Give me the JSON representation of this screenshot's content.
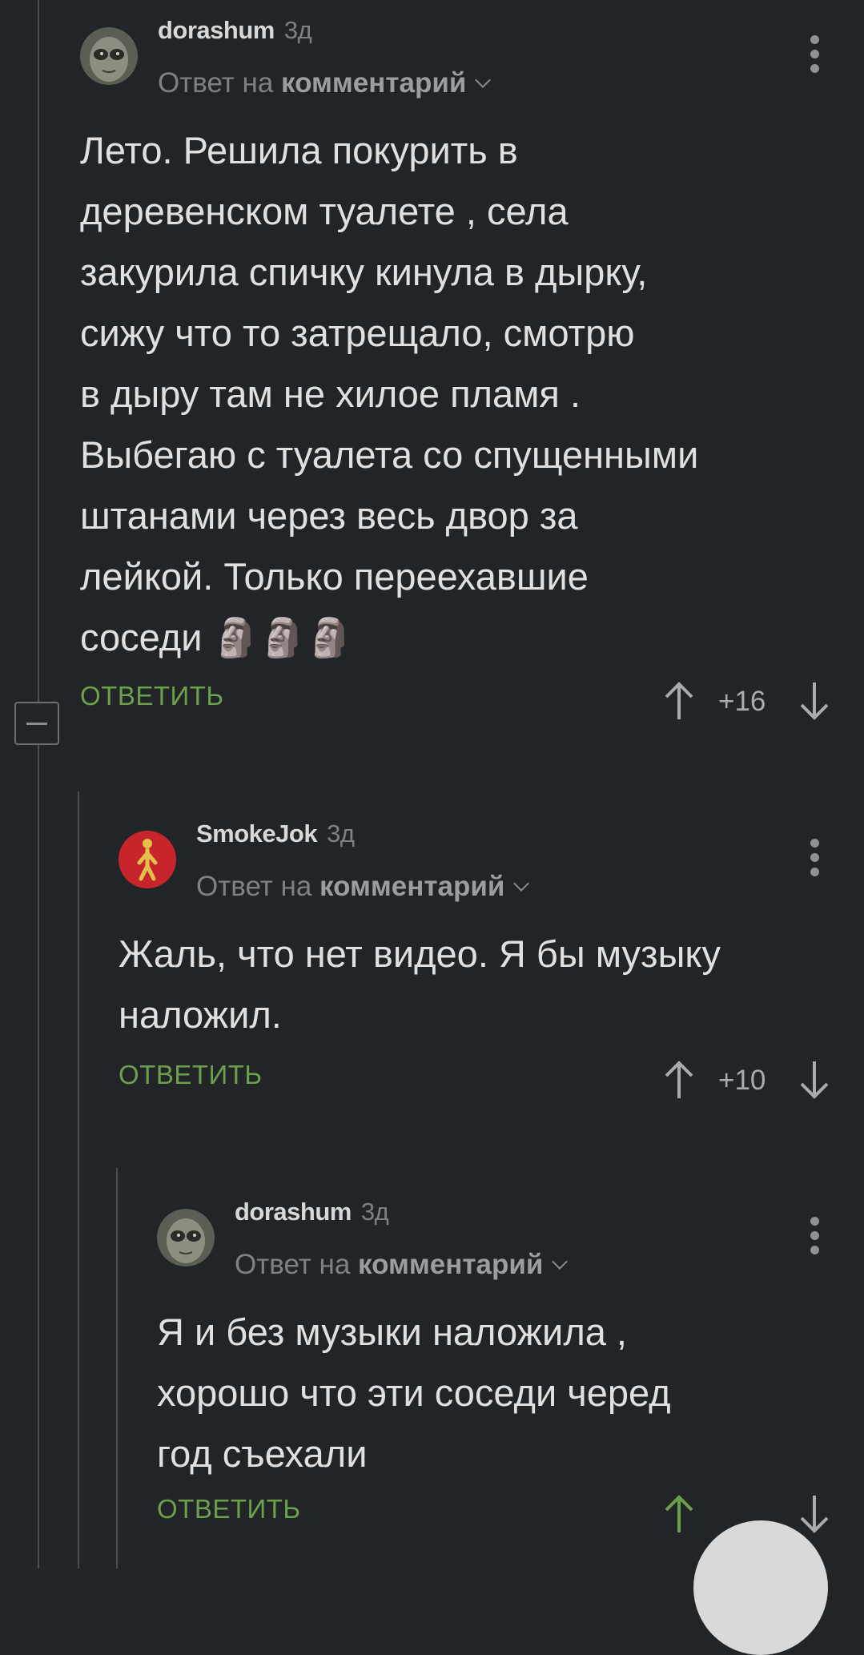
{
  "comments": [
    {
      "author": "dorashum",
      "time": "3д",
      "reply_prefix": "Ответ на",
      "reply_target": "комментарий",
      "lines": [
        "Лето. Решила покурить в",
        "деревенском туалете , села",
        "закурила спичку кинула в дырку,",
        "сижу что то затрещало, смотрю",
        "в дыру там не хилое пламя .",
        "Выбегаю с туалета со спущенными",
        "штанами через весь двор за",
        "лейкой. Только переехавшие",
        "соседи 🗿🗿🗿"
      ],
      "reply_label": "ОТВЕТИТЬ",
      "score": "+16"
    },
    {
      "author": "SmokeJok",
      "time": "3д",
      "reply_prefix": "Ответ на",
      "reply_target": "комментарий",
      "lines": [
        "Жаль, что нет видео. Я бы музыку",
        "наложил."
      ],
      "reply_label": "ОТВЕТИТЬ",
      "score": "+10"
    },
    {
      "author": "dorashum",
      "time": "3д",
      "reply_prefix": "Ответ на",
      "reply_target": "комментарий",
      "lines": [
        "Я и без музыки наложила ,",
        "хорошо что эти соседи черед",
        "год съехали"
      ],
      "reply_label": "ОТВЕТИТЬ",
      "score": ""
    }
  ],
  "colors": {
    "background": "#222528",
    "reply_green": "#6ca04a",
    "upvote_green": "#6ca04a",
    "smokejok_avatar": "#c8242b"
  },
  "icons": [
    "avatar-alien-icon",
    "avatar-walker-icon",
    "more-vertical-icon",
    "upvote-arrow-icon",
    "downvote-arrow-icon",
    "collapse-minus-icon",
    "chevron-down-icon"
  ]
}
